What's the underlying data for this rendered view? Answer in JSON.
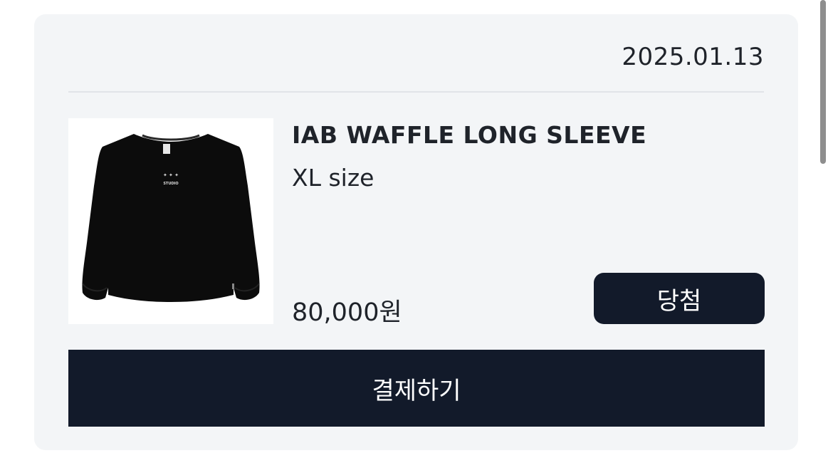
{
  "order": {
    "date": "2025.01.13",
    "product_name": "IAB WAFFLE LONG SLEEVE",
    "option": "XL size",
    "price": "80,000원",
    "status_button_label": "당첨",
    "product_image": {
      "icon": "black-sweatshirt-image",
      "print_top": "✦ ✦ ✦",
      "print_bottom": "STUDIO"
    }
  },
  "actions": {
    "pay_label": "결제하기"
  },
  "colors": {
    "card_bg": "#f3f5f7",
    "button_bg": "#121a2a",
    "text": "#1f232a"
  }
}
